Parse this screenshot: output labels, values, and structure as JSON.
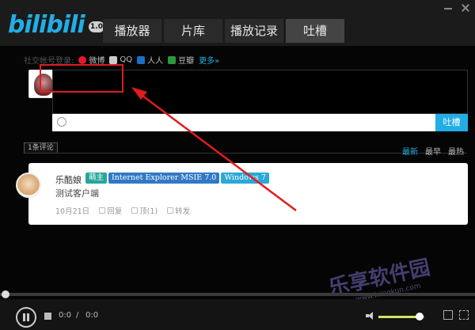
{
  "app": {
    "logo_text": "bilibili",
    "version": "1.0"
  },
  "tabs": [
    {
      "label": "播放器",
      "active": false
    },
    {
      "label": "片库",
      "active": false
    },
    {
      "label": "播放记录",
      "active": false
    },
    {
      "label": "吐槽",
      "active": true
    }
  ],
  "social": {
    "prompt": "社交帐号登录:",
    "items": [
      {
        "label": "微博",
        "icon": "weibo-icon"
      },
      {
        "label": "QQ",
        "icon": "qq-icon"
      },
      {
        "label": "人人",
        "icon": "renren-icon"
      },
      {
        "label": "豆瓣",
        "icon": "douban-icon"
      }
    ],
    "more": "更多»"
  },
  "composer": {
    "send_label": "吐槽"
  },
  "comments_header": {
    "count_label": "1条评论",
    "sorts": [
      {
        "label": "最新",
        "active": true
      },
      {
        "label": "最早",
        "active": false
      },
      {
        "label": "最热",
        "active": false
      }
    ]
  },
  "comment": {
    "user": "乐酷娘",
    "badges": {
      "owner": "萌主",
      "browser": "Internet Explorer MSIE 7.0",
      "os": "Windows 7"
    },
    "text": "测试客户端",
    "date": "10月21日",
    "reply": "回复",
    "like": "顶(1)",
    "share": "转发"
  },
  "watermark": {
    "title": "乐享软件园",
    "url": "www.lxiaokun.com"
  },
  "player": {
    "current_time": "0:0",
    "separator": "/",
    "total_time": "0:0",
    "volume_fraction": 0.9,
    "progress_fraction": 0.0
  },
  "colors": {
    "accent": "#23ade5",
    "annotation": "#e01c1c"
  }
}
